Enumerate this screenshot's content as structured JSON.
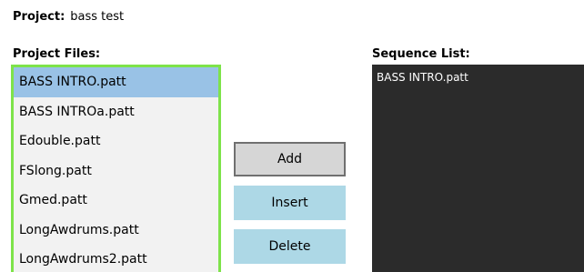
{
  "project": {
    "label": "Project:",
    "name": "bass test"
  },
  "project_files": {
    "label": "Project Files:",
    "items": [
      "BASS INTRO.patt",
      "BASS INTROa.patt",
      "Edouble.patt",
      "FSlong.patt",
      "Gmed.patt",
      "LongAwdrums.patt",
      "LongAwdrums2.patt"
    ],
    "selected_index": 0
  },
  "buttons": {
    "add": "Add",
    "insert": "Insert",
    "delete": "Delete"
  },
  "sequence_list": {
    "label": "Sequence List:",
    "items": [
      "BASS INTRO.patt"
    ]
  },
  "colors": {
    "selection": "#99c2e6",
    "list_border": "#7ee34a",
    "button_blue": "#add8e6",
    "sequence_bg": "#2b2b2b"
  }
}
